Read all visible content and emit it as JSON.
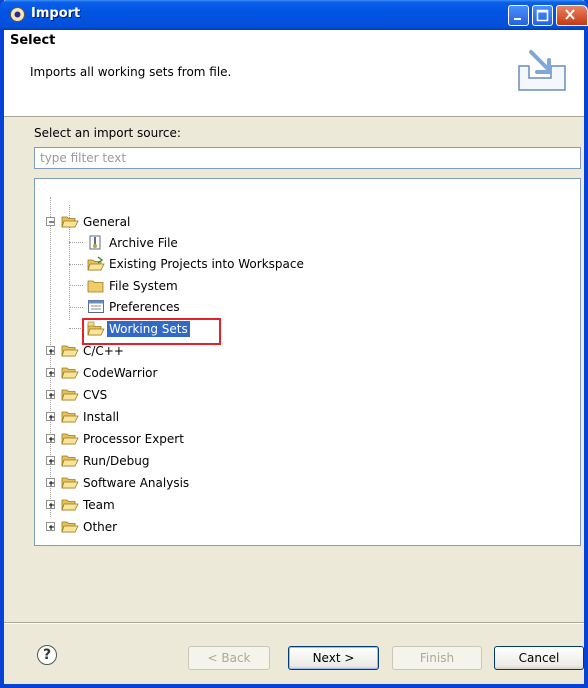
{
  "window": {
    "title": "Import"
  },
  "header": {
    "title": "Select",
    "description": "Imports all working sets from file."
  },
  "source": {
    "label": "Select an import source:",
    "filter_placeholder": "type filter text"
  },
  "tree": {
    "general": {
      "label": "General",
      "children": [
        "Archive File",
        "Existing Projects into Workspace",
        "File System",
        "Preferences",
        "Working Sets"
      ],
      "selected": "Working Sets"
    },
    "categories": [
      "C/C++",
      "CodeWarrior",
      "CVS",
      "Install",
      "Processor Expert",
      "Run/Debug",
      "Software Analysis",
      "Team",
      "Other"
    ]
  },
  "buttons": {
    "back": "< Back",
    "next": "Next >",
    "finish": "Finish",
    "cancel": "Cancel"
  },
  "help": "?",
  "colors": {
    "selection": "#316ac5",
    "highlight": "#e8202a",
    "titlebar": "#0054e3"
  }
}
